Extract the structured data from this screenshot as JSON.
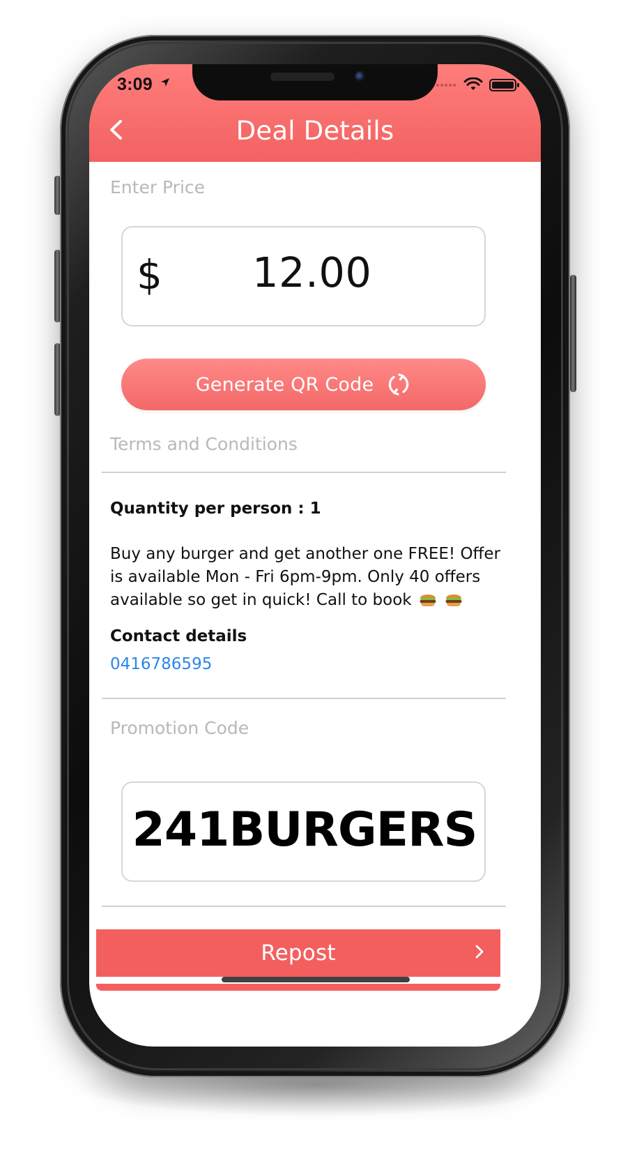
{
  "status_bar": {
    "time": "3:09"
  },
  "navigation": {
    "title": "Deal Details"
  },
  "price_section": {
    "label": "Enter Price",
    "currency": "$",
    "value": "12.00"
  },
  "qr_button": {
    "label": "Generate QR Code"
  },
  "terms_section": {
    "label": "Terms and Conditions",
    "quantity_line": "Quantity per person : 1",
    "description": "Buy any burger and get another one FREE! Offer is available Mon - Fri 6pm-9pm. Only 40 offers available so get in quick! Call to book",
    "contact_label": "Contact details",
    "contact_phone": "0416786595"
  },
  "promotion_section": {
    "label": "Promotion Code",
    "code": "241BURGERS"
  },
  "repost_button": {
    "label": "Repost"
  },
  "colors": {
    "accent": "#f35f5f",
    "link": "#2b86ea"
  },
  "icons": {
    "back": "chevron-left-icon",
    "location": "location-arrow-icon",
    "wifi": "wifi-icon",
    "battery": "battery-icon",
    "refresh": "refresh-icon",
    "repost_chevron": "chevron-right-icon",
    "burger": "burger-icon"
  }
}
